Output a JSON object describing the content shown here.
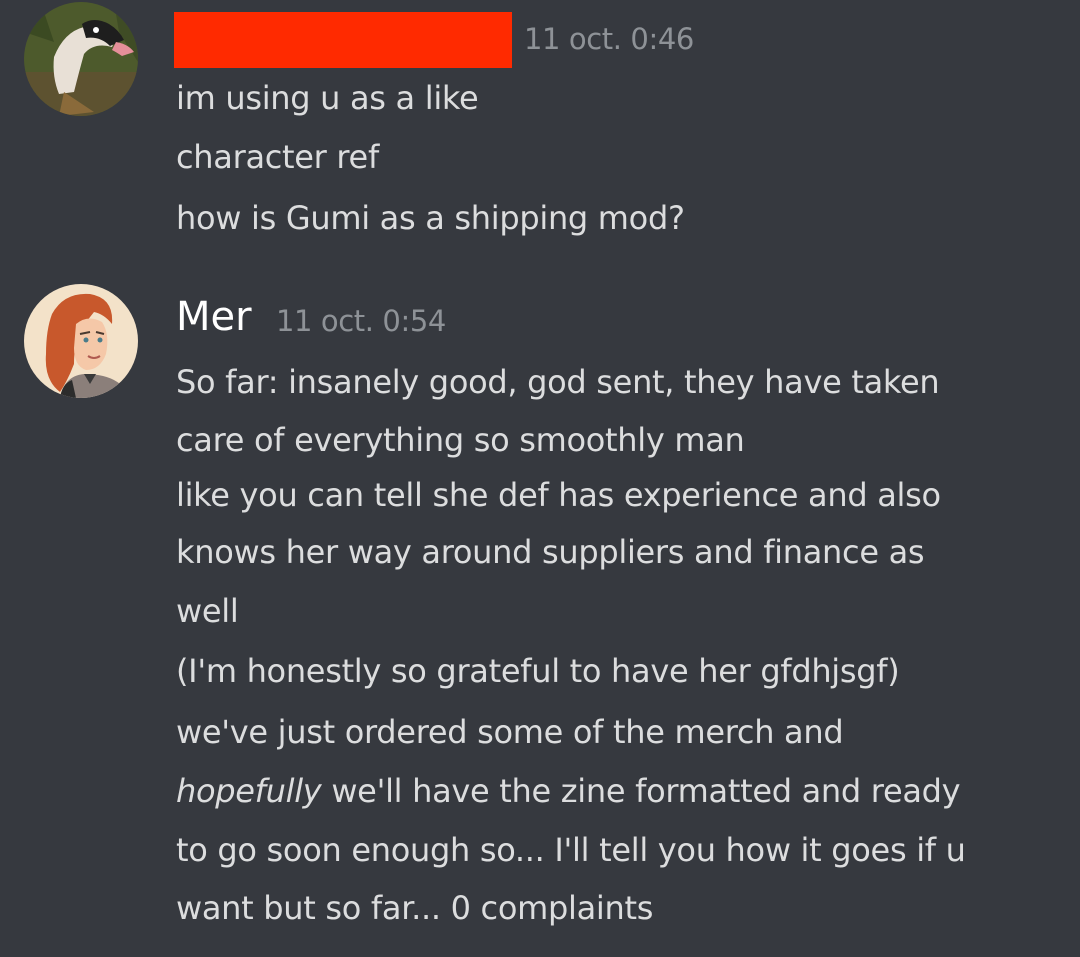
{
  "message1": {
    "author_redacted": true,
    "timestamp": "11 oct. 0:46",
    "lines": [
      "im using u as a like",
      "character ref",
      "how is Gumi as a shipping mod?"
    ]
  },
  "message2": {
    "author": "Mer",
    "timestamp": "11 oct. 0:54",
    "lines": [
      "So far: insanely good, god sent, they have taken",
      "care of everything so smoothly man",
      "like you can tell she def has experience and also",
      "knows her way around suppliers and finance as",
      "well",
      "(I'm honestly so grateful to have her gfdhjsgf)",
      "we've just ordered some of the merch and",
      "we'll have the zine formatted and ready",
      "to go soon enough so... I'll tell you how it goes if u",
      "want but so far... 0 complaints"
    ],
    "italic_word": "hopefully"
  },
  "colors": {
    "background": "#36393f",
    "text": "#dcddde",
    "timestamp": "#8e9297",
    "redaction": "#ff2a00",
    "username": "#ffffff"
  }
}
